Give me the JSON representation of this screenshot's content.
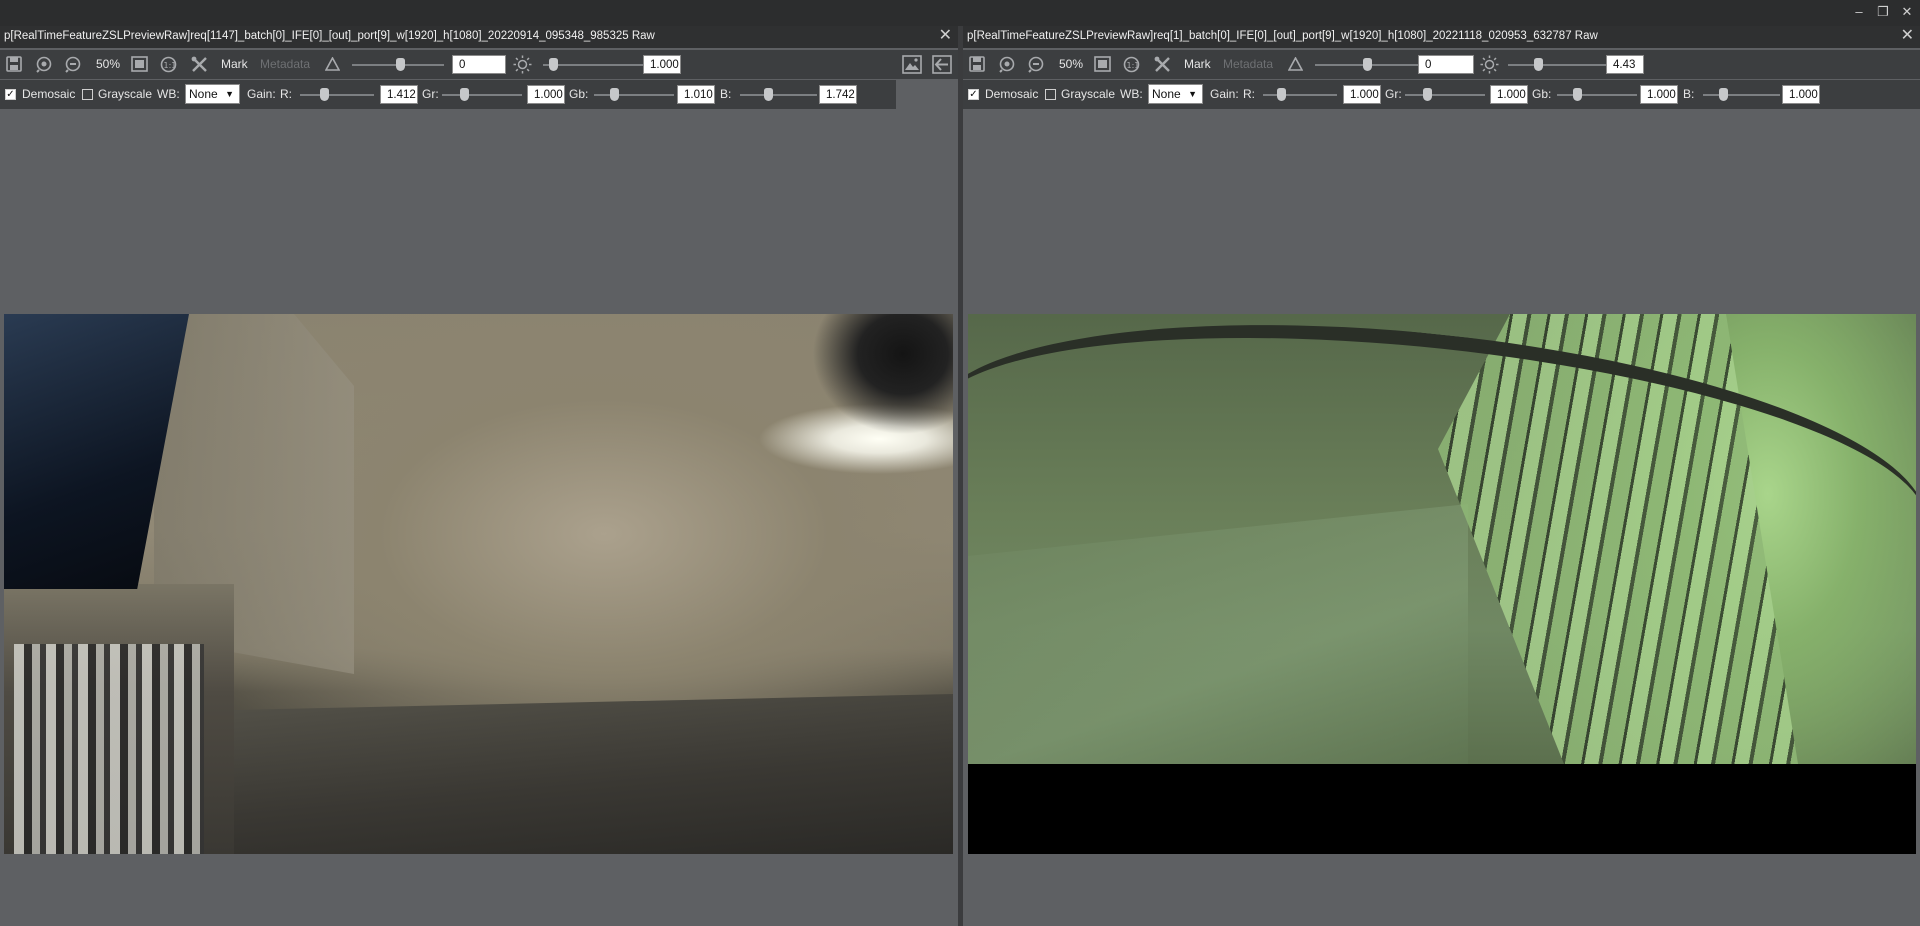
{
  "window": {
    "controls": [
      "–",
      "❐",
      "✕"
    ]
  },
  "left": {
    "title": "p[RealTimeFeatureZSLPreviewRaw]req[1147]_batch[0]_IFE[0]_[out]_port[9]_w[1920]_h[1080]_20220914_095348_985325 Raw",
    "zoom": "50%",
    "mark": "Mark",
    "metadata": "Metadata",
    "contrast_value": "0",
    "brightness_value": "1.000",
    "demosaic": "Demosaic",
    "demosaic_checked": true,
    "grayscale": "Grayscale",
    "grayscale_checked": false,
    "wb_label": "WB:",
    "wb_value": "None",
    "gain_label": "Gain:",
    "r_label": "R:",
    "r_value": "1.412",
    "gr_label": "Gr:",
    "gr_value": "1.000",
    "gb_label": "Gb:",
    "gb_value": "1.010",
    "b_label": "B:",
    "b_value": "1.742"
  },
  "right": {
    "title": "p[RealTimeFeatureZSLPreviewRaw]req[1]_batch[0]_IFE[0]_[out]_port[9]_w[1920]_h[1080]_20221118_020953_632787 Raw",
    "zoom": "50%",
    "mark": "Mark",
    "metadata": "Metadata",
    "contrast_value": "0",
    "brightness_value": "4.43",
    "demosaic": "Demosaic",
    "demosaic_checked": true,
    "grayscale": "Grayscale",
    "grayscale_checked": false,
    "wb_label": "WB:",
    "wb_value": "None",
    "gain_label": "Gain:",
    "r_label": "R:",
    "r_value": "1.000",
    "gr_label": "Gr:",
    "gr_value": "1.000",
    "gb_label": "Gb:",
    "gb_value": "1.000",
    "b_label": "B:",
    "b_value": "1.000"
  },
  "icons": {
    "close": "✕",
    "check": "✓",
    "dropdown": "▼",
    "save": "save-icon",
    "zoom_in": "zoom-in-icon",
    "zoom_out": "zoom-out-icon",
    "fit": "fit-window-icon",
    "one_to_one": "one-to-one-icon",
    "tools": "tools-icon",
    "contrast": "delta-icon",
    "brightness": "sun-icon",
    "image": "image-icon",
    "back": "arrow-left-icon"
  },
  "colors": {
    "background": "#5e6063",
    "toolbar": "#3c3e40",
    "titlebar": "#2f3031"
  }
}
